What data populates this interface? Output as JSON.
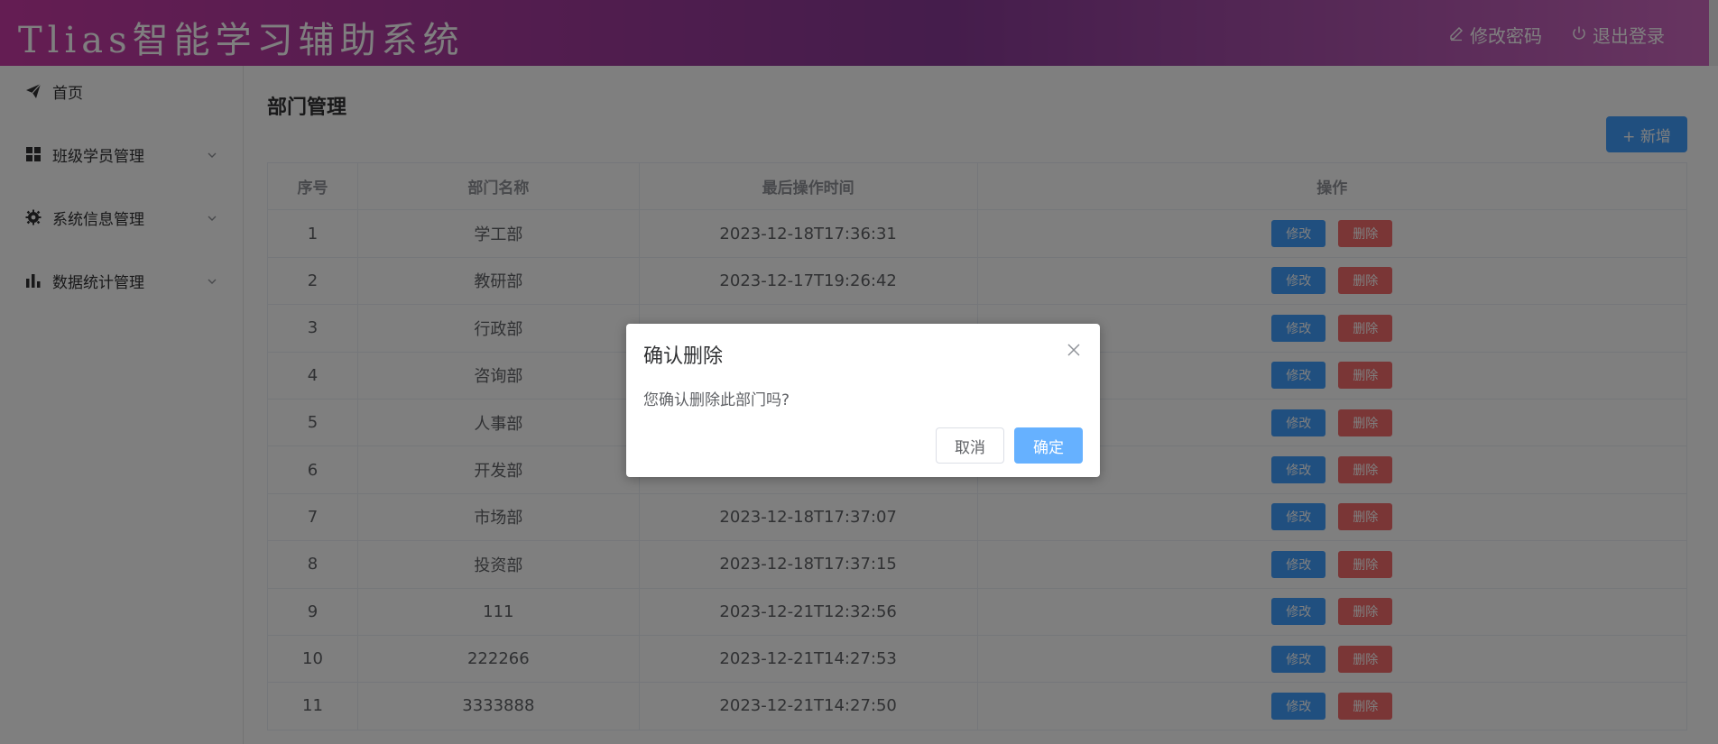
{
  "header": {
    "title": "Tlias智能学习辅助系统",
    "change_password": "修改密码",
    "logout": "退出登录"
  },
  "sidebar": {
    "items": [
      {
        "label": "首页",
        "icon": "send-icon"
      },
      {
        "label": "班级学员管理",
        "icon": "grid-icon"
      },
      {
        "label": "系统信息管理",
        "icon": "gear-icon"
      },
      {
        "label": "数据统计管理",
        "icon": "bar-chart-icon"
      }
    ]
  },
  "main": {
    "title": "部门管理",
    "add_button": "+ 新增",
    "table": {
      "headers": [
        "序号",
        "部门名称",
        "最后操作时间",
        "操作"
      ],
      "rows": [
        {
          "index": "1",
          "name": "学工部",
          "time": "2023-12-18T17:36:31"
        },
        {
          "index": "2",
          "name": "教研部",
          "time": "2023-12-17T19:26:42"
        },
        {
          "index": "3",
          "name": "行政部",
          "time": ""
        },
        {
          "index": "4",
          "name": "咨询部",
          "time": ""
        },
        {
          "index": "5",
          "name": "人事部",
          "time": ""
        },
        {
          "index": "6",
          "name": "开发部",
          "time": ""
        },
        {
          "index": "7",
          "name": "市场部",
          "time": "2023-12-18T17:37:07"
        },
        {
          "index": "8",
          "name": "投资部",
          "time": "2023-12-18T17:37:15"
        },
        {
          "index": "9",
          "name": "111",
          "time": "2023-12-21T12:32:56"
        },
        {
          "index": "10",
          "name": "222266",
          "time": "2023-12-21T14:27:53"
        },
        {
          "index": "11",
          "name": "3333888",
          "time": "2023-12-21T14:27:50"
        }
      ],
      "edit_label": "修改",
      "delete_label": "删除"
    }
  },
  "dialog": {
    "title": "确认删除",
    "message": "您确认删除此部门吗?",
    "cancel": "取消",
    "confirm": "确定"
  },
  "colors": {
    "primary": "#409eff",
    "danger": "#f56c6c",
    "header_gradient_start": "#c93aa6",
    "header_gradient_end": "#d06ac2"
  }
}
